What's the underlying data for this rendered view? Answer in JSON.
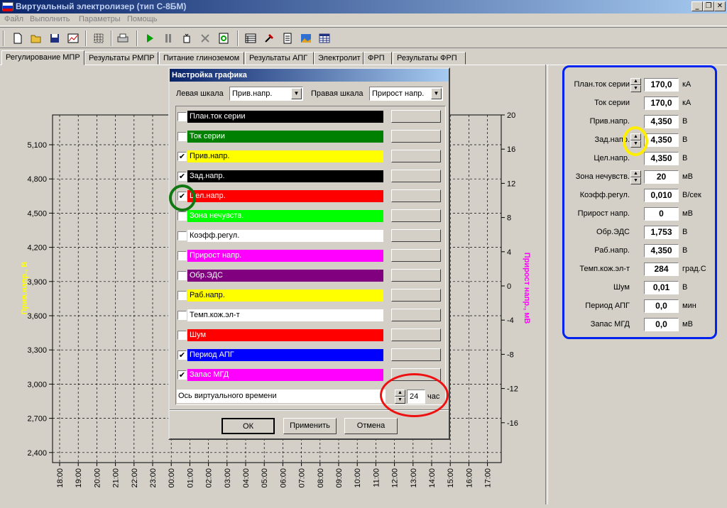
{
  "window": {
    "title": "Виртуальный электролизер (тип С-8БМ)",
    "flag_colors": [
      "#ffffff",
      "#0033cc",
      "#dd0000"
    ]
  },
  "menu": [
    "Файл",
    "Выполнить",
    "Параметры",
    "Помощь"
  ],
  "toolbar_icons": [
    "new-icon",
    "open-icon",
    "save-icon",
    "chart-icon",
    "grid-icon",
    "print-icon",
    "play-icon",
    "pause-icon",
    "step-icon",
    "stop-icon",
    "refresh-icon",
    "table-icon",
    "tools-icon",
    "document-icon",
    "image-icon",
    "spreadsheet-icon"
  ],
  "tabs": [
    "Регулирование МПР",
    "Результаты РМПР",
    "Питание глиноземом",
    "Результаты АПГ",
    "Электролит",
    "ФРП",
    "Результаты ФРП"
  ],
  "chart": {
    "left_axis_label": "Прив.напр., В",
    "right_axis_label": "Прирост напр., мВ",
    "left_ticks": [
      "5,100",
      "4,800",
      "4,500",
      "4,200",
      "3,900",
      "3,600",
      "3,300",
      "3,000",
      "2,700",
      "2,400"
    ],
    "right_ticks": [
      "20",
      "16",
      "12",
      "8",
      "4",
      "0",
      "-4",
      "-8",
      "-12",
      "-16"
    ],
    "x_ticks": [
      "18:00",
      "19:00",
      "20:00",
      "21:00",
      "22:00",
      "23:00",
      "00:00",
      "01:00",
      "02:00",
      "03:00",
      "04:00",
      "05:00",
      "06:00",
      "07:00",
      "08:00",
      "09:00",
      "10:00",
      "11:00",
      "12:00",
      "13:00",
      "14:00",
      "15:00",
      "16:00",
      "17:00"
    ],
    "left_color": "#ffff00",
    "right_color": "#ff00ff"
  },
  "params": [
    {
      "label": "План.ток серии",
      "value": "170,0",
      "unit": "кА",
      "spin": true
    },
    {
      "label": "Ток серии",
      "value": "170,0",
      "unit": "кА",
      "spin": false
    },
    {
      "label": "Прив.напр.",
      "value": "4,350",
      "unit": "В",
      "spin": false
    },
    {
      "label": "Зад.напр.",
      "value": "4,350",
      "unit": "В",
      "spin": true
    },
    {
      "label": "Цел.напр.",
      "value": "4,350",
      "unit": "В",
      "spin": false
    },
    {
      "label": "Зона нечувств.",
      "value": "20",
      "unit": "мВ",
      "spin": true
    },
    {
      "label": "Коэфф.регул.",
      "value": "0,010",
      "unit": "В/сек",
      "spin": false
    },
    {
      "label": "Прирост напр.",
      "value": "0",
      "unit": "мВ",
      "spin": false
    },
    {
      "label": "Обр.ЭДС",
      "value": "1,753",
      "unit": "В",
      "spin": false
    },
    {
      "label": "Раб.напр.",
      "value": "4,350",
      "unit": "В",
      "spin": false
    },
    {
      "label": "Темп.кож.эл-т",
      "value": "284",
      "unit": "град.С",
      "spin": false
    },
    {
      "label": "Шум",
      "value": "0,01",
      "unit": "В",
      "spin": false
    },
    {
      "label": "Период АПГ",
      "value": "0,0",
      "unit": "мин",
      "spin": false
    },
    {
      "label": "Запас МГД",
      "value": "0,0",
      "unit": "мВ",
      "spin": false
    }
  ],
  "dialog": {
    "title": "Настройка графика",
    "left_scale_label": "Левая шкала",
    "left_scale_value": "Прив.напр.",
    "right_scale_label": "Правая шкала",
    "right_scale_value": "Прирост напр.",
    "series": [
      {
        "label": "План.ток серии",
        "checked": false,
        "bg": "#000000",
        "fg": "#ffffff"
      },
      {
        "label": "Ток серии",
        "checked": false,
        "bg": "#008000",
        "fg": "#ffffff"
      },
      {
        "label": "Прив.напр.",
        "checked": true,
        "bg": "#ffff00",
        "fg": "#000000"
      },
      {
        "label": "Зад.напр.",
        "checked": true,
        "bg": "#000000",
        "fg": "#ffffff"
      },
      {
        "label": "Цел.напр.",
        "checked": true,
        "bg": "#ff0000",
        "fg": "#ffffff"
      },
      {
        "label": "Зона нечувств.",
        "checked": false,
        "bg": "#00ff00",
        "fg": "#ffffff"
      },
      {
        "label": "Коэфф.регул.",
        "checked": false,
        "bg": "#ffffff",
        "fg": "#000000"
      },
      {
        "label": "Прирост напр.",
        "checked": false,
        "bg": "#ff00ff",
        "fg": "#ffffff"
      },
      {
        "label": "Обр.ЭДС",
        "checked": false,
        "bg": "#800080",
        "fg": "#ffffff"
      },
      {
        "label": "Раб.напр.",
        "checked": false,
        "bg": "#ffff00",
        "fg": "#000000"
      },
      {
        "label": "Темп.кож.эл-т",
        "checked": false,
        "bg": "#ffffff",
        "fg": "#000000"
      },
      {
        "label": "Шум",
        "checked": false,
        "bg": "#ff0000",
        "fg": "#ffffff"
      },
      {
        "label": "Период АПГ",
        "checked": true,
        "bg": "#0000ff",
        "fg": "#ffffff"
      },
      {
        "label": "Запас МГД",
        "checked": true,
        "bg": "#ff00ff",
        "fg": "#ffffff"
      }
    ],
    "time_axis_label": "Ось виртуального времени",
    "time_axis_value": "24",
    "time_axis_unit": "час",
    "ok": "ОК",
    "apply": "Применить",
    "cancel": "Отмена"
  },
  "annotation_colors": {
    "blue": "#0022ee",
    "yellow": "#ffee00",
    "green": "#117711",
    "red": "#ee1111"
  }
}
